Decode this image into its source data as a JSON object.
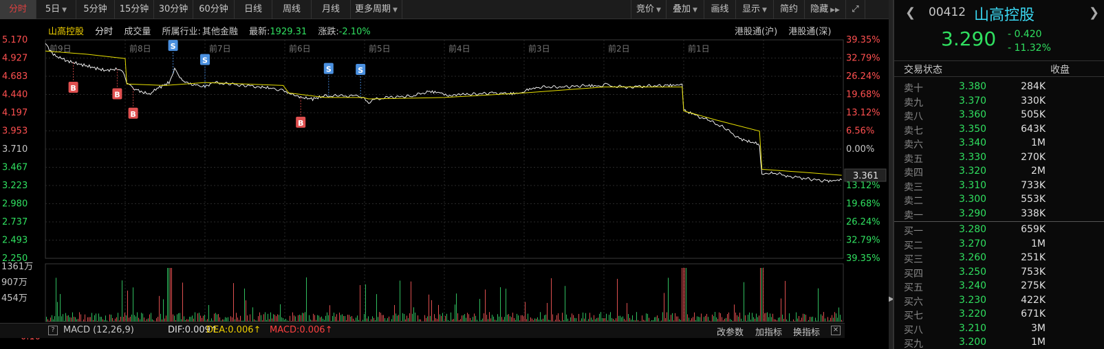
{
  "toolbar": {
    "left_items": [
      {
        "label": "分时",
        "active": true,
        "dropdown": false
      },
      {
        "label": "5日",
        "active": false,
        "dropdown": true
      },
      {
        "label": "5分钟",
        "active": false,
        "dropdown": false
      },
      {
        "label": "15分钟",
        "active": false,
        "dropdown": false
      },
      {
        "label": "30分钟",
        "active": false,
        "dropdown": false
      },
      {
        "label": "60分钟",
        "active": false,
        "dropdown": false
      },
      {
        "label": "日线",
        "active": false,
        "dropdown": false
      },
      {
        "label": "周线",
        "active": false,
        "dropdown": false
      },
      {
        "label": "月线",
        "active": false,
        "dropdown": false
      },
      {
        "label": "更多周期",
        "active": false,
        "dropdown": true
      }
    ],
    "right_items": [
      {
        "label": "竞价",
        "dropdown": true
      },
      {
        "label": "叠加",
        "dropdown": true
      },
      {
        "label": "画线",
        "dropdown": false
      },
      {
        "label": "显示",
        "dropdown": true
      },
      {
        "label": "简约",
        "dropdown": false
      },
      {
        "label": "隐藏",
        "dropdown": false
      }
    ]
  },
  "header": {
    "stock_name": "山高控股",
    "period": "分时",
    "volume_label": "成交量",
    "industry_label": "所属行业:",
    "industry": "其他金融",
    "latest_label": "最新:",
    "latest": "1929.31",
    "change_label": "涨跌:",
    "change": "-2.10%"
  },
  "hk_links": [
    "港股通(沪)",
    "港股通(深)"
  ],
  "chart_data": {
    "type": "line",
    "day_labels": [
      "前9日",
      "前8日",
      "前7日",
      "前6日",
      "前5日",
      "前4日",
      "前3日",
      "前2日",
      "前1日"
    ],
    "y_left_ticks": [
      "5.170",
      "4.927",
      "4.683",
      "4.440",
      "4.197",
      "3.953",
      "3.710",
      "3.467",
      "3.223",
      "2.980",
      "2.737",
      "2.493",
      "2.250"
    ],
    "y_right_ticks": [
      "39.35%",
      "32.79%",
      "26.24%",
      "19.68%",
      "13.12%",
      "6.56%",
      "0.00%",
      "",
      "13.12%",
      "19.68%",
      "26.24%",
      "32.79%",
      "39.35%"
    ],
    "ylim": [
      2.25,
      5.17
    ],
    "current_price_tag": "3.361",
    "volume_ticks": [
      "1361万",
      "907万",
      "454万"
    ],
    "macd_axis_label": "0.10",
    "markers": [
      {
        "type": "B",
        "day_pos": 0.35
      },
      {
        "type": "B",
        "day_pos": 0.9
      },
      {
        "type": "B",
        "day_pos": 1.1
      },
      {
        "type": "S",
        "day_pos": 1.6
      },
      {
        "type": "S",
        "day_pos": 2.0
      },
      {
        "type": "B",
        "day_pos": 3.2
      },
      {
        "type": "S",
        "day_pos": 3.55
      },
      {
        "type": "S",
        "day_pos": 3.95
      }
    ],
    "price_path": [
      [
        0.0,
        5.12
      ],
      [
        0.1,
        4.97
      ],
      [
        0.2,
        4.92
      ],
      [
        0.3,
        4.88
      ],
      [
        0.45,
        4.84
      ],
      [
        0.6,
        4.8
      ],
      [
        0.75,
        4.76
      ],
      [
        0.9,
        4.78
      ],
      [
        0.98,
        4.72
      ],
      [
        1.02,
        4.6
      ],
      [
        1.1,
        4.52
      ],
      [
        1.2,
        4.48
      ],
      [
        1.3,
        4.44
      ],
      [
        1.4,
        4.52
      ],
      [
        1.55,
        4.6
      ],
      [
        1.62,
        4.78
      ],
      [
        1.7,
        4.64
      ],
      [
        1.8,
        4.58
      ],
      [
        1.9,
        4.56
      ],
      [
        2.0,
        4.54
      ],
      [
        2.1,
        4.6
      ],
      [
        2.3,
        4.58
      ],
      [
        2.5,
        4.56
      ],
      [
        2.7,
        4.54
      ],
      [
        2.85,
        4.52
      ],
      [
        2.98,
        4.5
      ],
      [
        3.05,
        4.46
      ],
      [
        3.2,
        4.4
      ],
      [
        3.35,
        4.38
      ],
      [
        3.5,
        4.42
      ],
      [
        3.7,
        4.42
      ],
      [
        3.9,
        4.42
      ],
      [
        3.98,
        4.4
      ],
      [
        4.05,
        4.32
      ],
      [
        4.1,
        4.37
      ],
      [
        4.3,
        4.4
      ],
      [
        4.6,
        4.42
      ],
      [
        4.8,
        4.48
      ],
      [
        4.98,
        4.46
      ],
      [
        5.05,
        4.42
      ],
      [
        5.3,
        4.44
      ],
      [
        5.6,
        4.46
      ],
      [
        5.8,
        4.45
      ],
      [
        5.98,
        4.46
      ],
      [
        6.02,
        4.5
      ],
      [
        6.2,
        4.54
      ],
      [
        6.5,
        4.54
      ],
      [
        6.8,
        4.56
      ],
      [
        6.98,
        4.55
      ],
      [
        7.02,
        4.58
      ],
      [
        7.1,
        4.55
      ],
      [
        7.3,
        4.54
      ],
      [
        7.5,
        4.55
      ],
      [
        7.8,
        4.56
      ],
      [
        7.98,
        4.57
      ],
      [
        8.0,
        4.23
      ],
      [
        8.1,
        4.18
      ],
      [
        8.3,
        4.1
      ],
      [
        8.5,
        4.0
      ],
      [
        8.7,
        3.85
      ],
      [
        8.85,
        3.8
      ],
      [
        8.92,
        3.78
      ],
      [
        8.95,
        3.74
      ],
      [
        8.98,
        3.38
      ],
      [
        9.1,
        3.4
      ],
      [
        9.3,
        3.35
      ],
      [
        9.5,
        3.32
      ],
      [
        9.8,
        3.28
      ],
      [
        9.98,
        3.3
      ]
    ],
    "avg_path": [
      [
        0.0,
        5.02
      ],
      [
        0.5,
        4.98
      ],
      [
        1.0,
        4.92
      ],
      [
        1.02,
        4.58
      ],
      [
        1.5,
        4.56
      ],
      [
        2.0,
        4.6
      ],
      [
        2.5,
        4.58
      ],
      [
        2.98,
        4.56
      ],
      [
        3.05,
        4.46
      ],
      [
        3.5,
        4.4
      ],
      [
        3.98,
        4.4
      ],
      [
        4.05,
        4.38
      ],
      [
        5.0,
        4.4
      ],
      [
        6.0,
        4.46
      ],
      [
        7.0,
        4.54
      ],
      [
        7.98,
        4.54
      ],
      [
        8.0,
        4.22
      ],
      [
        8.4,
        4.1
      ],
      [
        8.95,
        3.95
      ],
      [
        8.98,
        3.44
      ],
      [
        9.5,
        3.4
      ],
      [
        9.98,
        3.36
      ]
    ]
  },
  "indicator": {
    "help": "?",
    "macd_label": "MACD (12,26,9)",
    "dif": "DIF:0.009↑",
    "dea": "DEA:0.006↑",
    "macd": "MACD:0.006↑",
    "edit_params": "改参数",
    "add_indicator": "加指标",
    "switch_indicator": "换指标",
    "close": "✕"
  },
  "quote": {
    "code": "00412",
    "name": "山高控股",
    "price": "3.290",
    "change": "- 0.420",
    "change_pct": "- 11.32%",
    "status_label": "交易状态",
    "status": "收盘",
    "asks": [
      {
        "label": "卖十",
        "price": "3.380",
        "vol": "284K"
      },
      {
        "label": "卖九",
        "price": "3.370",
        "vol": "330K"
      },
      {
        "label": "卖八",
        "price": "3.360",
        "vol": "505K"
      },
      {
        "label": "卖七",
        "price": "3.350",
        "vol": "643K"
      },
      {
        "label": "卖六",
        "price": "3.340",
        "vol": "1M"
      },
      {
        "label": "卖五",
        "price": "3.330",
        "vol": "270K"
      },
      {
        "label": "卖四",
        "price": "3.320",
        "vol": "2M"
      },
      {
        "label": "卖三",
        "price": "3.310",
        "vol": "733K"
      },
      {
        "label": "卖二",
        "price": "3.300",
        "vol": "553K"
      },
      {
        "label": "卖一",
        "price": "3.290",
        "vol": "338K"
      }
    ],
    "bids": [
      {
        "label": "买一",
        "price": "3.280",
        "vol": "659K"
      },
      {
        "label": "买二",
        "price": "3.270",
        "vol": "1M"
      },
      {
        "label": "买三",
        "price": "3.260",
        "vol": "251K"
      },
      {
        "label": "买四",
        "price": "3.250",
        "vol": "753K"
      },
      {
        "label": "买五",
        "price": "3.240",
        "vol": "275K"
      },
      {
        "label": "买六",
        "price": "3.230",
        "vol": "422K"
      },
      {
        "label": "买七",
        "price": "3.220",
        "vol": "671K"
      },
      {
        "label": "买八",
        "price": "3.210",
        "vol": "3M"
      },
      {
        "label": "买九",
        "price": "3.200",
        "vol": "1M"
      }
    ]
  }
}
